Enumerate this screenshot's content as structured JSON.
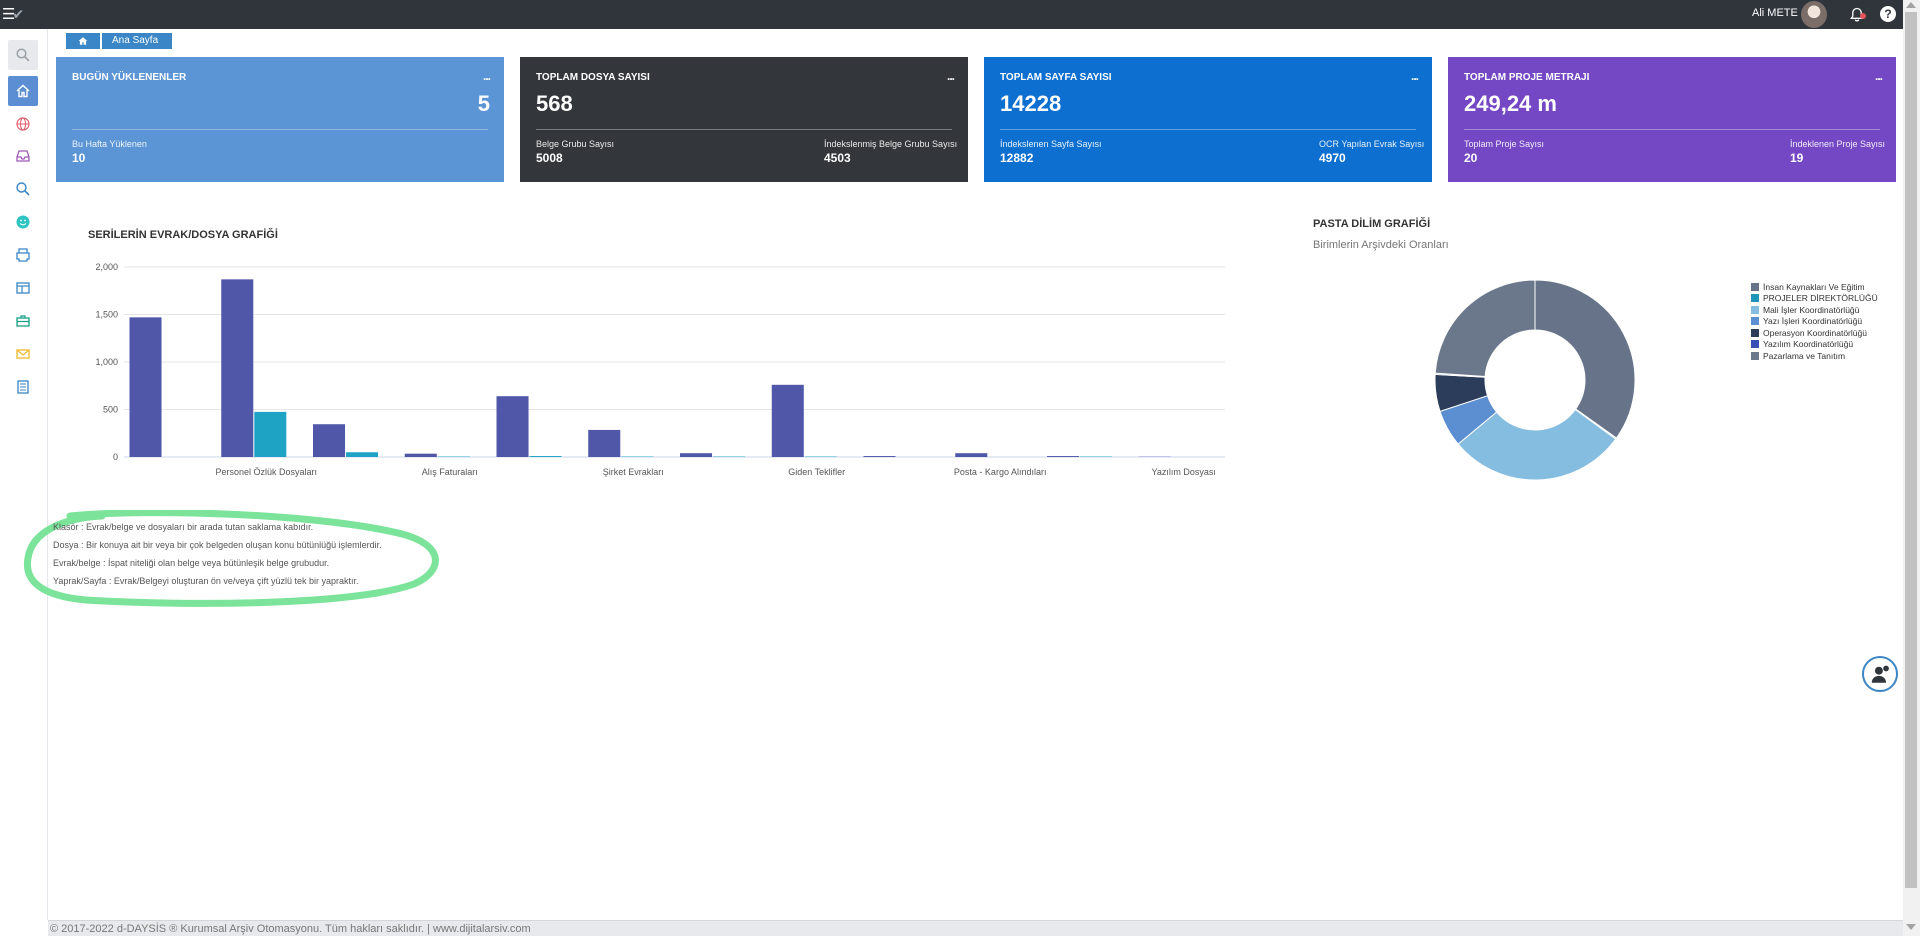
{
  "user": {
    "name": "Ali METE"
  },
  "help_label": "?",
  "breadcrumb": {
    "home_icon": "home-icon",
    "current": "Ana Sayfa"
  },
  "sidebar": {
    "items": [
      {
        "icon": "search-icon"
      },
      {
        "icon": "home-icon"
      },
      {
        "icon": "globe-icon"
      },
      {
        "icon": "inbox-icon"
      },
      {
        "icon": "magnifier-icon"
      },
      {
        "icon": "smile-icon"
      },
      {
        "icon": "printer-icon"
      },
      {
        "icon": "layout-icon"
      },
      {
        "icon": "briefcase-icon"
      },
      {
        "icon": "envelope-icon"
      },
      {
        "icon": "list-icon"
      }
    ]
  },
  "cards": [
    {
      "title": "BUGÜN YÜKLENENLER",
      "dots": "...",
      "value": "5",
      "color": "#5b95d6",
      "left": {
        "label": "Bu Hafta Yüklenen",
        "value": "10"
      }
    },
    {
      "title": "TOPLAM DOSYA SAYISI",
      "dots": "...",
      "value": "568",
      "color": "#33363b",
      "left": {
        "label": "Belge Grubu Sayısı",
        "value": "5008"
      },
      "right": {
        "label": "İndekslenmiş Belge Grubu Sayısı",
        "value": "4503"
      }
    },
    {
      "title": "TOPLAM SAYFA SAYISI",
      "dots": "...",
      "value": "14228",
      "color": "#0d6fcf",
      "left": {
        "label": "İndekslenen Sayfa Sayısı",
        "value": "12882"
      },
      "right": {
        "label": "OCR Yapılan Evrak Sayısı",
        "value": "4970"
      }
    },
    {
      "title": "TOPLAM PROJE METRAJI",
      "dots": "...",
      "value": "249,24 m",
      "color": "#7447c5",
      "left": {
        "label": "Toplam Proje Sayısı",
        "value": "20"
      },
      "right": {
        "label": "İndeklenen Proje Sayısı",
        "value": "19"
      }
    }
  ],
  "bar_chart_title": "SERİLERİN EVRAK/DOSYA GRAFİĞİ",
  "chart_data": [
    {
      "type": "bar",
      "title": "SERİLERİN EVRAK/DOSYA GRAFİĞİ",
      "ylim": [
        0,
        2000
      ],
      "yticks": [
        "0",
        "500",
        "1,000",
        "1,500",
        "2,000"
      ],
      "categories": [
        "",
        "Personel Özlük Dosyaları",
        "",
        "Alış Faturaları",
        "",
        "Şirket Evrakları",
        "",
        "Giden Teklifler",
        "",
        "Posta - Kargo Alındıları",
        "",
        "Yazılım Dosyası"
      ],
      "series": [
        {
          "color": "#5056a8",
          "values": [
            1470,
            1870,
            345,
            35,
            640,
            285,
            40,
            760,
            10,
            40,
            10,
            3
          ]
        },
        {
          "color": "#1ea3c4",
          "values": [
            0,
            475,
            50,
            5,
            10,
            5,
            5,
            5,
            0,
            0,
            5,
            0
          ]
        }
      ]
    },
    {
      "type": "pie",
      "title": "PASTA DİLİM GRAFİĞİ",
      "subtitle": "Birimlerin Arşivdeki Oranları",
      "slices": [
        {
          "name": "İnsan Kaynakları Ve Eğitim",
          "value": 35,
          "color": "#667389"
        },
        {
          "name": "PROJELER DİREKTÖRLÜĞÜ",
          "value": 0.2,
          "color": "#1e96b8"
        },
        {
          "name": "Mali İşler Koordinatörlüğü",
          "value": 29,
          "color": "#85bde0"
        },
        {
          "name": "Yazı İşleri Koordinatörlüğü",
          "value": 6,
          "color": "#5b8fd2"
        },
        {
          "name": "Operasyon Koordinatörlüğü",
          "value": 6,
          "color": "#2b3d5b"
        },
        {
          "name": "Yazılım Koordinatörlüğü",
          "value": 0.2,
          "color": "#3a4fb5"
        },
        {
          "name": "Pazarlama ve Tanıtım",
          "value": 24,
          "color": "#6b788c"
        }
      ]
    }
  ],
  "pie": {
    "title": "PASTA DİLİM GRAFİĞİ",
    "subtitle": "Birimlerin Arşivdeki Oranları"
  },
  "glossary": [
    "Klasör : Evrak/belge ve dosyaları bir arada tutan saklama kabıdır.",
    "Dosya : Bir konuya ait bir veya bir çok belgeden oluşan konu bütünlüğü işlemlerdir.",
    "Evrak/belge : İspat niteliği olan belge veya bütünleşik belge grubudur.",
    "Yaprak/Sayfa : Evrak/Belgeyi oluşturan ön ve/veya çift yüzlü tek bir yapraktır."
  ],
  "footer": {
    "text": "© 2017-2022 d-DAYSİS ® Kurumsal Arşiv Otomasyonu. Tüm hakları saklıdır. | www.dijitalarsiv.com"
  }
}
